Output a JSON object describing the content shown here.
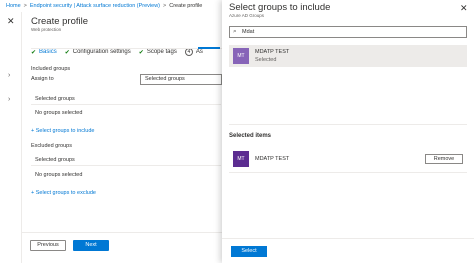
{
  "breadcrumb": {
    "items": [
      "Home",
      "Endpoint security | Attack surface reduction (Preview)",
      "Create profile"
    ],
    "separator": ">"
  },
  "main": {
    "title": "Create profile",
    "subtitle": "Web protection",
    "tabs": [
      {
        "label": "Basics",
        "state": "complete"
      },
      {
        "label": "Configuration settings",
        "state": "complete"
      },
      {
        "label": "Scope tags",
        "state": "complete"
      },
      {
        "label": "As",
        "state": "active",
        "number": "4"
      }
    ],
    "included_groups_label": "Included groups",
    "assign_to_label": "Assign to",
    "assign_to_value": "Selected groups",
    "included_header": "Selected groups",
    "included_empty": "No groups selected",
    "select_include_link": "+ Select groups to include",
    "excluded_groups_label": "Excluded groups",
    "excluded_header": "Selected groups",
    "excluded_empty": "No groups selected",
    "select_exclude_link": "+ Select groups to exclude",
    "previous_label": "Previous",
    "next_label": "Next"
  },
  "panel": {
    "title": "Select groups to include",
    "subtitle": "Azure AD Groups",
    "search_value": "Mdat",
    "result": {
      "initials": "MT",
      "name": "MDATP TEST",
      "state": "Selected"
    },
    "selected_heading": "Selected items",
    "selected_item": {
      "initials": "MT",
      "name": "MDATP TEST"
    },
    "remove_label": "Remove",
    "select_label": "Select"
  },
  "colors": {
    "accent": "#0078d4",
    "result_avatar": "#8764b8",
    "selected_avatar": "#5c2d91",
    "check": "#107c10"
  }
}
